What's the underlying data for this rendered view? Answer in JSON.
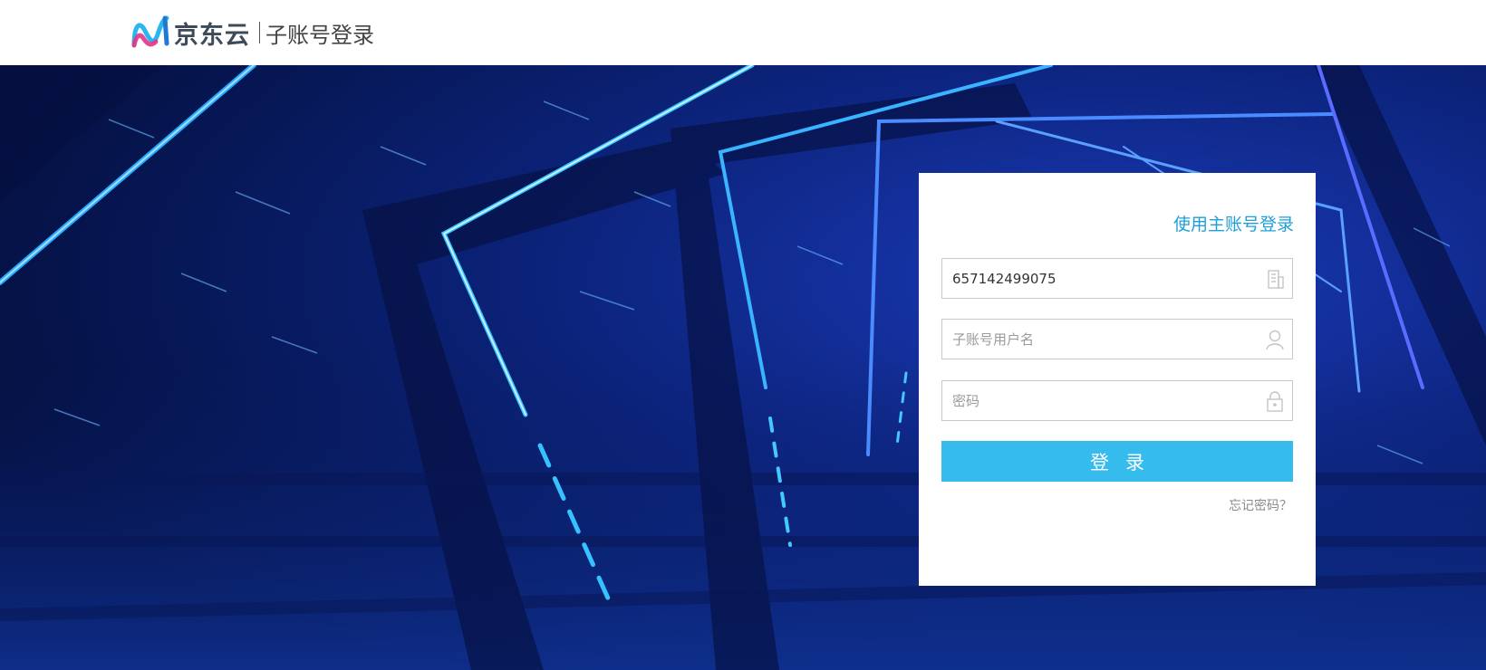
{
  "header": {
    "logo_icon": "jd-cloud-logo-icon",
    "brand": "京东云",
    "subtitle": "子账号登录"
  },
  "login": {
    "switch_link": "使用主账号登录",
    "account_id": {
      "value": "657142499075",
      "icon": "building-icon"
    },
    "username": {
      "value": "",
      "placeholder": "子账号用户名",
      "icon": "user-icon"
    },
    "password": {
      "value": "",
      "placeholder": "密码",
      "icon": "lock-icon"
    },
    "submit_label": "登录",
    "forgot_link": "忘记密码？"
  },
  "colors": {
    "accent": "#35bbec",
    "link": "#1e9fd8",
    "background": "#071a5c"
  }
}
